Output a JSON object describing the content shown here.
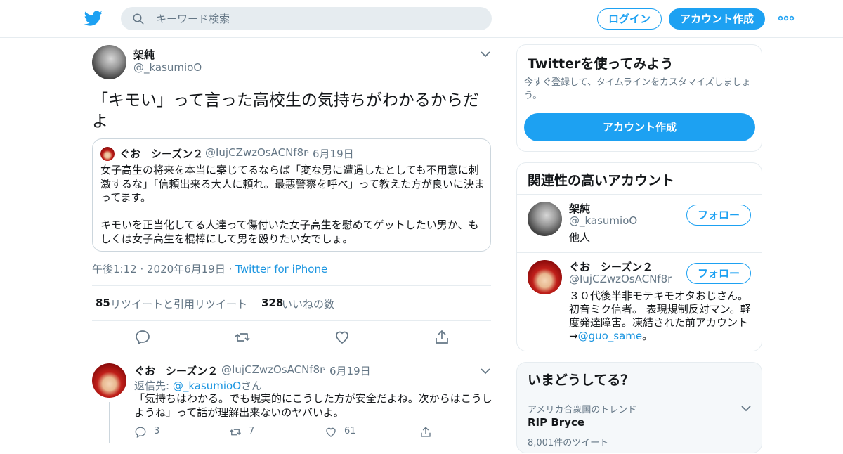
{
  "header": {
    "search_placeholder": "キーワード検索",
    "login_label": "ログイン",
    "signup_label": "アカウント作成"
  },
  "tweet": {
    "author_name": "架純",
    "author_handle": "@_kasumioO",
    "text": "「キモい」って言った高校生の気持ちがわかるからだよ",
    "quote": {
      "author_name": "ぐお　シーズン２",
      "author_handle": "@IujCZwzOsACNf8r",
      "date": "6月19日",
      "text": "女子高生の将来を本当に案じてるならば「変な男に遭遇したとしても不用意に刺激するな」「信頼出来る大人に頼れ。最悪警察を呼べ」って教えた方が良いに決まってます。\n\nキモいを正当化してる人達って傷付いた女子高生を慰めてゲットしたい男か、もしくは女子高生を棍棒にして男を殴りたい女でしょ。"
    },
    "time": "午後1:12",
    "date": "2020年6月19日",
    "source": "Twitter for iPhone",
    "retweets": "85",
    "retweets_label": "リツイートと引用リツイート",
    "likes": "328",
    "likes_label": "いいねの数"
  },
  "reply": {
    "author_name": "ぐお　シーズン２",
    "author_handle": "@IujCZwzOsACNf8r",
    "date": "6月19日",
    "reply_to_prefix": "返信先: ",
    "reply_to_handle": "@_kasumioO",
    "reply_to_suffix": "さん",
    "text": "「気持ちはわかる。でも現実的にこうした方が安全だよね。次からはこうしようね」って話が理解出来ないのヤバいよ。",
    "reply_count": "3",
    "retweet_count": "7",
    "like_count": "61"
  },
  "sidebar": {
    "try_title": "Twitterを使ってみよう",
    "try_subtitle": "今すぐ登録して、タイムラインをカスタマイズしましょう。",
    "try_button": "アカウント作成",
    "related_title": "関連性の高いアカウント",
    "accounts": [
      {
        "name": "架純",
        "handle": "@_kasumioO",
        "bio": "他人",
        "follow_label": "フォロー"
      },
      {
        "name": "ぐお　シーズン２",
        "handle": "@IujCZwzOsACNf8r",
        "bio": "３０代後半非モテキモオタおじさん。初音ミク信者。 表現規制反対マン。軽度発達障害。凍結された前アカウント→",
        "bio_link": "@guo_same",
        "bio_suffix": "。",
        "follow_label": "フォロー"
      }
    ],
    "trends_title": "いまどうしてる？",
    "trend_context": "アメリカ合衆国のトレンド",
    "trend_name": "RIP Bryce",
    "trend_count": "8,001件のツイート"
  },
  "colors": {
    "accent": "#1da1f2",
    "link": "#1b95e0",
    "muted": "#657786",
    "border": "#e6ecf0"
  }
}
